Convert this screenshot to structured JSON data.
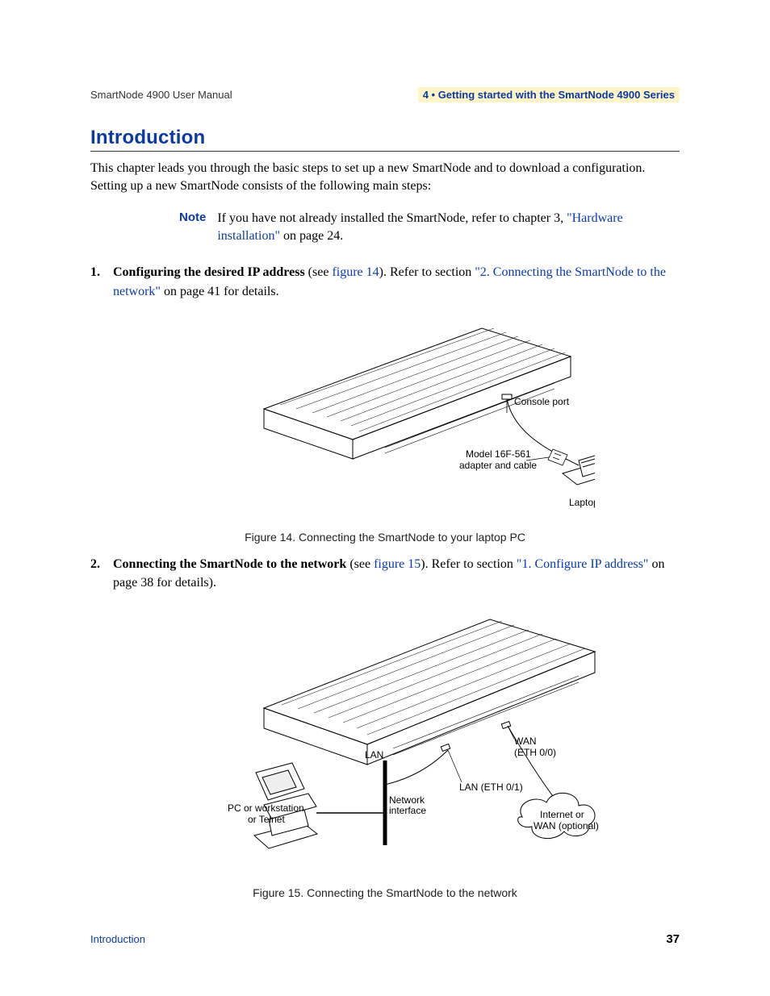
{
  "header": {
    "left": "SmartNode 4900 User Manual",
    "right": "4 • Getting started with the SmartNode 4900 Series"
  },
  "section_title": "Introduction",
  "intro_para": "This chapter leads you through the basic steps to set up a new SmartNode and to download a configuration. Setting up a new SmartNode consists of the following main steps:",
  "note": {
    "label": "Note",
    "text_before_link": "If you have not already installed the SmartNode, refer to chapter 3, ",
    "link_text": "\"Hardware installation\"",
    "text_after_link": " on page 24."
  },
  "steps": [
    {
      "bold": "Configuring the desired IP address",
      "after_bold": " (see ",
      "fig_link": "figure 14",
      "after_fig": "). Refer to section ",
      "sec_link": "\"2. Connecting the SmartNode to the network\"",
      "tail": " on page 41 for details."
    },
    {
      "bold": "Connecting the SmartNode to the network",
      "after_bold": " (see ",
      "fig_link": "figure 15",
      "after_fig": "). Refer to section ",
      "sec_link": "\"1. Configure IP address\"",
      "tail": " on page 38 for details)."
    }
  ],
  "figures": {
    "fig14": {
      "caption": "Figure 14. Connecting the SmartNode to your laptop PC",
      "labels": {
        "console_port": "Console port",
        "adapter_cable_line1": "Model 16F-561",
        "adapter_cable_line2": "adapter and cable",
        "laptop": "Laptop PC"
      }
    },
    "fig15": {
      "caption": "Figure 15. Connecting the SmartNode to the network",
      "labels": {
        "lan": "LAN",
        "wan": "WAN",
        "wan_sub": "(ETH 0/0)",
        "lan_port": "LAN (ETH 0/1)",
        "net_if_line1": "Network",
        "net_if_line2": "interface",
        "pc_line1": "PC or workstation",
        "pc_line2": "or Telnet",
        "cloud_line1": "Internet or",
        "cloud_line2": "WAN (optional)"
      }
    }
  },
  "footer": {
    "left": "Introduction",
    "right": "37"
  }
}
